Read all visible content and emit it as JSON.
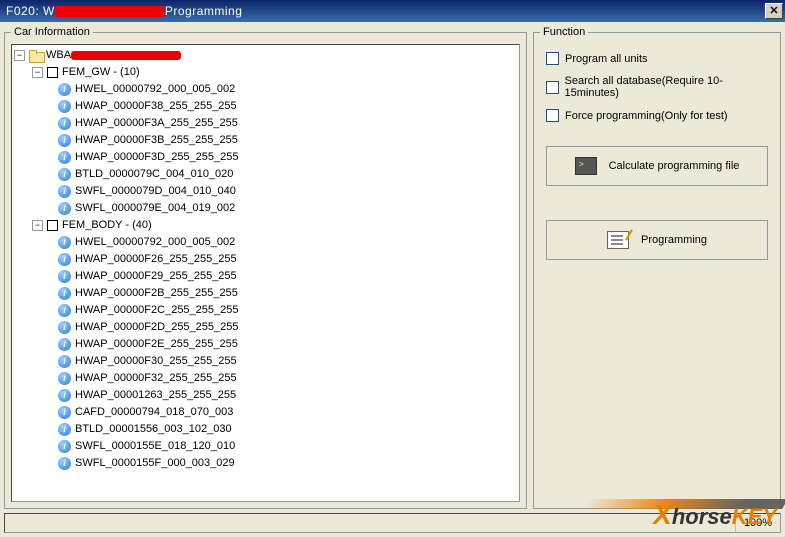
{
  "title_prefix": "F020: W",
  "title_suffix": "Programming",
  "panels": {
    "car_info": "Car Information",
    "function": "Function"
  },
  "tree": {
    "root_prefix": "WBA",
    "groups": [
      {
        "name": "FEM_GW",
        "count_suffix": " -  (10)",
        "items": [
          "HWEL_00000792_000_005_002",
          "HWAP_00000F38_255_255_255",
          "HWAP_00000F3A_255_255_255",
          "HWAP_00000F3B_255_255_255",
          "HWAP_00000F3D_255_255_255",
          "BTLD_0000079C_004_010_020",
          "SWFL_0000079D_004_010_040",
          "SWFL_0000079E_004_019_002"
        ]
      },
      {
        "name": "FEM_BODY",
        "count_suffix": " -  (40)",
        "items": [
          "HWEL_00000792_000_005_002",
          "HWAP_00000F26_255_255_255",
          "HWAP_00000F29_255_255_255",
          "HWAP_00000F2B_255_255_255",
          "HWAP_00000F2C_255_255_255",
          "HWAP_00000F2D_255_255_255",
          "HWAP_00000F2E_255_255_255",
          "HWAP_00000F30_255_255_255",
          "HWAP_00000F32_255_255_255",
          "HWAP_00001263_255_255_255",
          "CAFD_00000794_018_070_003",
          "BTLD_00001556_003_102_030",
          "SWFL_0000155E_018_120_010",
          "SWFL_0000155F_000_003_029"
        ]
      }
    ]
  },
  "checkboxes": {
    "program_all": "Program all units",
    "search_db": "Search all database(Require 10-15minutes)",
    "force": "Force programming(Only for test)"
  },
  "buttons": {
    "calculate": "Calculate programming file",
    "programming": "Programming"
  },
  "status": {
    "percent": "100%"
  },
  "watermark": {
    "brand_x": "X",
    "brand_mid": "horse",
    "brand_key": "KEY"
  }
}
